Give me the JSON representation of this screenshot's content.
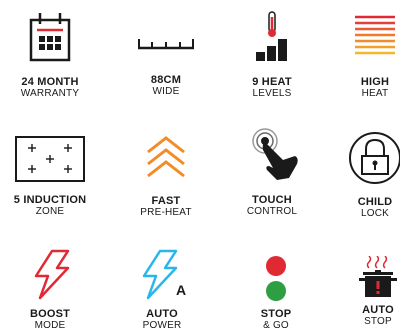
{
  "features": [
    {
      "title": "24 MONTH",
      "sub": "WARRANTY",
      "icon": "calendar-icon"
    },
    {
      "title": "88CM",
      "sub": "WIDE",
      "icon": "ruler-icon"
    },
    {
      "title": "9 HEAT",
      "sub": "LEVELS",
      "icon": "thermometer-bars-icon"
    },
    {
      "title": "HIGH",
      "sub": "HEAT",
      "icon": "heat-lines-icon"
    },
    {
      "title": "5 INDUCTION",
      "sub": "ZONE",
      "icon": "cooktop-icon"
    },
    {
      "title": "FAST",
      "sub": "PRE-HEAT",
      "icon": "chevrons-up-icon"
    },
    {
      "title": "TOUCH",
      "sub": "CONTROL",
      "icon": "touch-hand-icon"
    },
    {
      "title": "CHILD",
      "sub": "LOCK",
      "icon": "child-lock-icon"
    },
    {
      "title": "BOOST",
      "sub": "MODE",
      "icon": "lightning-icon"
    },
    {
      "title": "AUTO",
      "sub": "POWER",
      "icon": "auto-power-lightning-icon"
    },
    {
      "title": "STOP",
      "sub": "& GO",
      "icon": "stop-go-lights-icon"
    },
    {
      "title": "AUTO",
      "sub": "STOP",
      "icon": "boiling-pot-icon"
    }
  ],
  "icon_text": {
    "auto_power_letter": "A"
  },
  "colors": {
    "accent_red": "#e02a33",
    "accent_blue": "#2bb6ea",
    "accent_orange": "#f28c28",
    "accent_green": "#2e9e43",
    "dark": "#1a1a1a"
  }
}
